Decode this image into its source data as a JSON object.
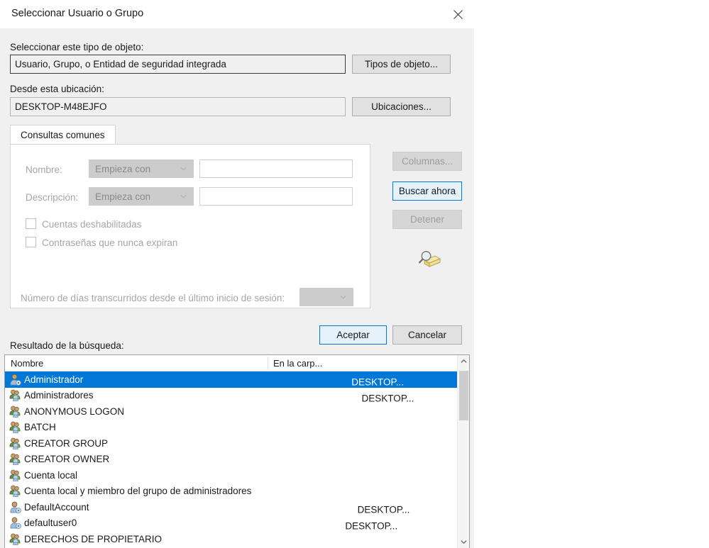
{
  "window": {
    "title": "Seleccionar Usuario o Grupo",
    "close_label": "Cerrar"
  },
  "object_type": {
    "label": "Seleccionar este tipo de objeto:",
    "value": "Usuario, Grupo, o Entidad de seguridad integrada",
    "button": "Tipos de objeto..."
  },
  "location": {
    "label": "Desde esta ubicación:",
    "value": "DESKTOP-M48EJFO",
    "button": "Ubicaciones..."
  },
  "tabs": [
    {
      "label": "Consultas comunes",
      "active": true
    }
  ],
  "query_form": {
    "name_label": "Nombre:",
    "name_operator": "Empieza con",
    "name_value": "",
    "description_label": "Descripción:",
    "description_operator": "Empieza con",
    "description_value": "",
    "disabled_accounts_label": "Cuentas deshabilitadas",
    "disabled_accounts_checked": false,
    "never_expire_label": "Contraseñas que nunca expiran",
    "never_expire_checked": false,
    "days_label": "Número de días transcurridos desde el último inicio de sesión:",
    "days_value": ""
  },
  "side_buttons": {
    "columns": "Columnas...",
    "find_now": "Buscar ahora",
    "stop": "Detener",
    "search_icon": "magnifier-folder-icon"
  },
  "dialog_buttons": {
    "ok": "Aceptar",
    "cancel": "Cancelar"
  },
  "results": {
    "label": "Resultado de la búsqueda:",
    "columns": [
      "Nombre",
      "En la carp..."
    ],
    "rows": [
      {
        "name": "Administrador",
        "folder": "DESKTOP...",
        "icon": "user-icon",
        "selected": true
      },
      {
        "name": "Administradores",
        "folder": "DESKTOP...",
        "icon": "group-icon",
        "selected": false
      },
      {
        "name": "ANONYMOUS LOGON",
        "folder": "",
        "icon": "group-icon",
        "selected": false
      },
      {
        "name": "BATCH",
        "folder": "",
        "icon": "group-icon",
        "selected": false
      },
      {
        "name": "CREATOR GROUP",
        "folder": "",
        "icon": "group-icon",
        "selected": false
      },
      {
        "name": "CREATOR OWNER",
        "folder": "",
        "icon": "group-icon",
        "selected": false
      },
      {
        "name": "Cuenta local",
        "folder": "",
        "icon": "group-icon",
        "selected": false
      },
      {
        "name": "Cuenta local y miembro del grupo de administradores",
        "folder": "",
        "icon": "group-icon",
        "selected": false
      },
      {
        "name": "DefaultAccount",
        "folder": "DESKTOP...",
        "icon": "user-icon",
        "selected": false
      },
      {
        "name": "defaultuser0",
        "folder": "DESKTOP...",
        "icon": "user-icon",
        "selected": false
      },
      {
        "name": "DERECHOS DE PROPIETARIO",
        "folder": "",
        "icon": "group-icon",
        "selected": false
      }
    ]
  },
  "colors": {
    "selection": "#0078d7",
    "dialog_bg": "#f0f0f0",
    "accent_border": "#0078d7"
  }
}
